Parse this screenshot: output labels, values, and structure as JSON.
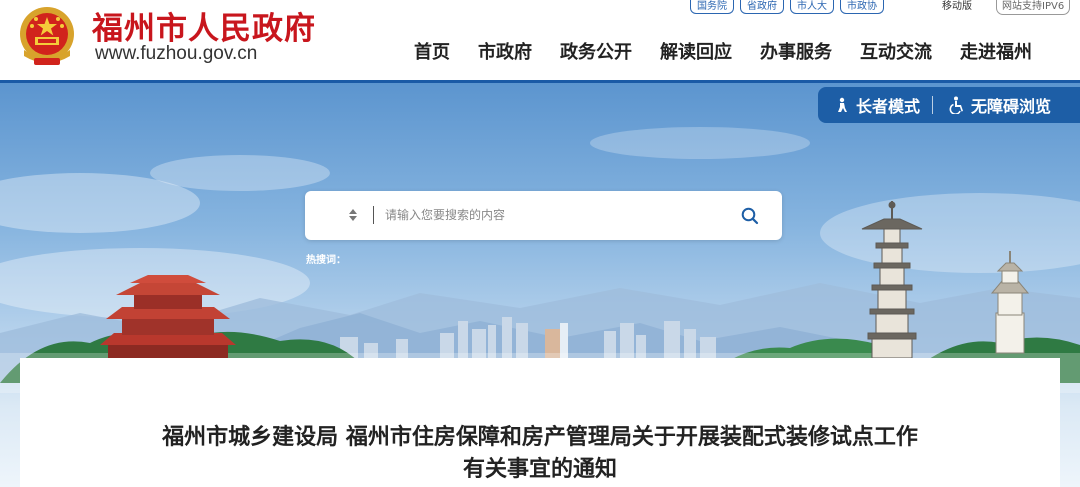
{
  "header": {
    "site_name": "福州市人民政府",
    "site_domain": "www.fuzhou.gov.cn",
    "emblem_icon": "national-emblem-icon"
  },
  "toplinks": [
    {
      "label": "国务院"
    },
    {
      "label": "省政府"
    },
    {
      "label": "市人大"
    },
    {
      "label": "市政协"
    }
  ],
  "mobile_label": "移动版",
  "ipv6_label": "网站支持IPV6",
  "nav": [
    {
      "label": "首页"
    },
    {
      "label": "市政府"
    },
    {
      "label": "政务公开"
    },
    {
      "label": "解读回应"
    },
    {
      "label": "办事服务"
    },
    {
      "label": "互动交流"
    },
    {
      "label": "走进福州"
    }
  ],
  "accessibility": {
    "elder_mode": "长者模式",
    "barrier_free": "无障碍浏览"
  },
  "search": {
    "placeholder": "请输入您要搜索的内容",
    "value": "",
    "hot_label": "热搜词："
  },
  "article": {
    "title_line1": "福州市城乡建设局 福州市住房保障和房产管理局关于开展装配式装修试点工作",
    "title_line2": "有关事宜的通知"
  },
  "colors": {
    "brand_red": "#c8161d",
    "brand_blue": "#1a5aa6",
    "access_bar": "#1d5ea6"
  }
}
